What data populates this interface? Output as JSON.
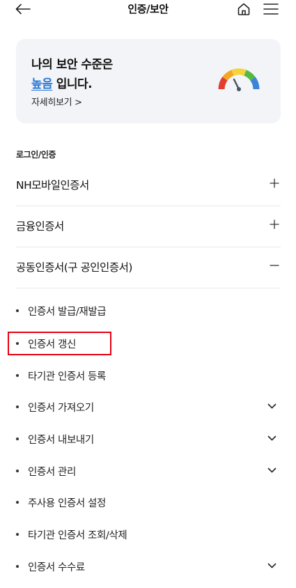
{
  "header": {
    "title": "인증/보안",
    "back_icon": "arrow-left-icon",
    "home_icon": "home-icon",
    "menu_icon": "hamburger-menu-icon"
  },
  "security_card": {
    "line1": "나의 보안 수준은",
    "level": "높음",
    "level_suffix": " 입니다.",
    "detail_link": "자세히보기 >",
    "gauge_icon": "security-gauge-icon",
    "level_color": "#2a78d6"
  },
  "section_label": "로그인/인증",
  "accordion": [
    {
      "label": "NH모바일인증서",
      "state": "+"
    },
    {
      "label": "금융인증서",
      "state": "+"
    },
    {
      "label": "공동인증서(구 공인인증서)",
      "state": "−"
    }
  ],
  "sub_items": [
    {
      "label": "인증서 발급/재발급",
      "has_chevron": false
    },
    {
      "label": "인증서 갱신",
      "has_chevron": false
    },
    {
      "label": "타기관 인증서 등록",
      "has_chevron": false
    },
    {
      "label": "인증서 가져오기",
      "has_chevron": true
    },
    {
      "label": "인증서 내보내기",
      "has_chevron": true
    },
    {
      "label": "인증서 관리",
      "has_chevron": true
    },
    {
      "label": "주사용 인증서 설정",
      "has_chevron": false
    },
    {
      "label": "타기관 인증서 조회/삭제",
      "has_chevron": false
    },
    {
      "label": "인증서 수수료",
      "has_chevron": true
    }
  ],
  "highlight_color": "#e60012"
}
